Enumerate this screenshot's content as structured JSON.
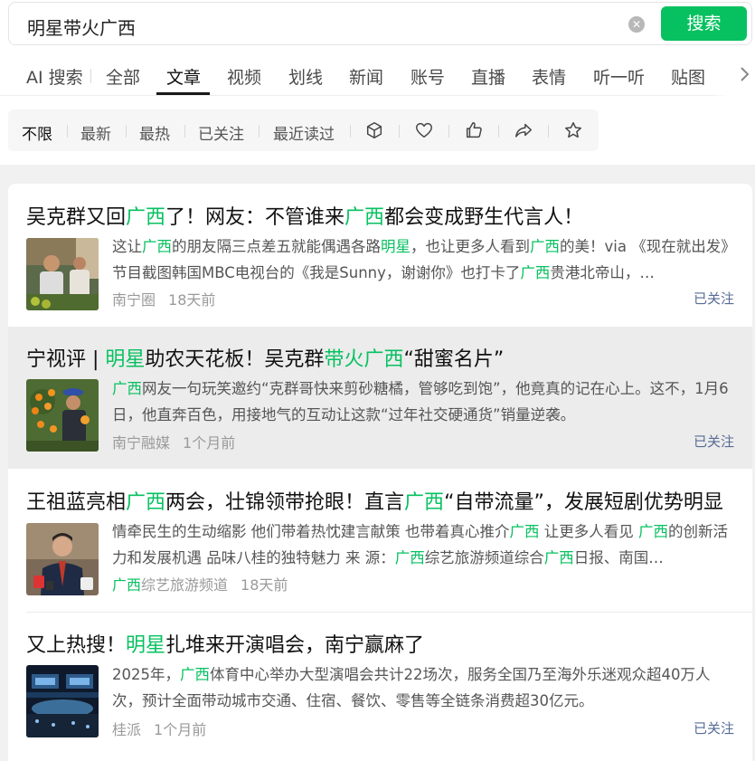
{
  "search": {
    "query": "明星带火广西",
    "button_label": "搜索"
  },
  "tabs": [
    "AI 搜索",
    "全部",
    "文章",
    "视频",
    "划线",
    "新闻",
    "账号",
    "直播",
    "表情",
    "听一听",
    "贴图"
  ],
  "active_tab": "文章",
  "filters": [
    "不限",
    "最新",
    "最热",
    "已关注",
    "最近读过"
  ],
  "filter_icons": [
    "cube-icon",
    "heart-icon",
    "thumbs-up-icon",
    "share-icon",
    "star-icon"
  ],
  "accent_color": "#07c160",
  "articles": [
    {
      "title_parts": [
        [
          "吴克群又回",
          0
        ],
        [
          "广西",
          1
        ],
        [
          "了！网友：不管谁来",
          0
        ],
        [
          "广西",
          1
        ],
        [
          "都会变成野生代言人！",
          0
        ]
      ],
      "snippet_parts": [
        [
          "这让",
          0
        ],
        [
          "广西",
          1
        ],
        [
          "的朋友隔三点差五就能偶遇各路",
          0
        ],
        [
          "明星",
          1
        ],
        [
          "，也让更多人看到",
          0
        ],
        [
          "广西",
          1
        ],
        [
          "的美！via 《现在就出发》节目截图韩国MBC电视台的《我是Sunny，谢谢你》也打卡了",
          0
        ],
        [
          "广西",
          1
        ],
        [
          "贵港北帝山，…",
          0
        ]
      ],
      "source": "南宁圈",
      "time": "18天前",
      "follow": "已关注"
    },
    {
      "title_parts": [
        [
          "宁视评 | ",
          0
        ],
        [
          "明星",
          1
        ],
        [
          "助农天花板！吴克群",
          0
        ],
        [
          "带火广西",
          1
        ],
        [
          "“甜蜜名片”",
          0
        ]
      ],
      "snippet_parts": [
        [
          "广西",
          1
        ],
        [
          "网友一句玩笑邀约“克群哥快来剪砂糖橘，管够吃到饱”，他竟真的记在心上。这不，1月6日，他直奔百色，用接地气的互动让这款“过年社交硬通货”销量逆袭。",
          0
        ]
      ],
      "source": "南宁融媒",
      "time": "1个月前",
      "follow": "已关注"
    },
    {
      "title_parts": [
        [
          "王祖蓝亮相",
          0
        ],
        [
          "广西",
          1
        ],
        [
          "两会，壮锦领带抢眼！直言",
          0
        ],
        [
          "广西",
          1
        ],
        [
          "“自带流量”，发展短剧优势明显",
          0
        ]
      ],
      "snippet_parts": [
        [
          "情牵民生的生动缩影 他们带着热忱建言献策 也带着真心推介",
          0
        ],
        [
          "广西",
          1
        ],
        [
          " 让更多人看见 ",
          0
        ],
        [
          "广西",
          1
        ],
        [
          "的创新活力和发展机遇 品味八桂的独特魅力 来 源：",
          0
        ],
        [
          "广西",
          1
        ],
        [
          "综艺旅游频道综合",
          0
        ],
        [
          "广西",
          1
        ],
        [
          "日报、南国…",
          0
        ]
      ],
      "source_parts": [
        [
          "广西",
          1
        ],
        [
          "综艺旅游频道",
          0
        ]
      ],
      "time": "18天前",
      "follow": ""
    },
    {
      "title_parts": [
        [
          "又上热搜！",
          0
        ],
        [
          "明星",
          1
        ],
        [
          "扎堆来开演唱会，南宁赢麻了",
          0
        ]
      ],
      "snippet_parts": [
        [
          "2025年，",
          0
        ],
        [
          "广西",
          1
        ],
        [
          "体育中心举办大型演唱会共计22场次，服务全国乃至海外乐迷观众超40万人次，预计全面带动城市交通、住宿、餐饮、零售等全链条消费超30亿元。",
          0
        ]
      ],
      "source": "桂派",
      "time": "1个月前",
      "follow": "已关注"
    }
  ]
}
